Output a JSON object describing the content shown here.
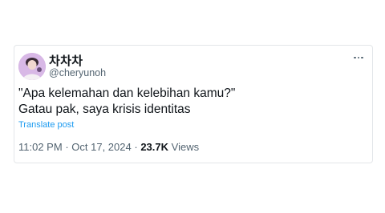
{
  "tweet": {
    "display_name": "차차차",
    "handle": "@cheryunoh",
    "text_line1": "\"Apa kelemahan dan kelebihan kamu?\"",
    "text_line2": "Gatau pak, saya krisis identitas",
    "translate_label": "Translate post",
    "time": "11:02 PM",
    "date": "Oct 17, 2024",
    "separator": "·",
    "views_count": "23.7K",
    "views_label": "Views"
  },
  "icons": {
    "avatar": "profile-photo",
    "more": "more-horizontal-icon"
  },
  "colors": {
    "primary_text": "#0f1419",
    "secondary_text": "#536471",
    "link": "#1d9bf0",
    "border": "#e3e6e9"
  }
}
